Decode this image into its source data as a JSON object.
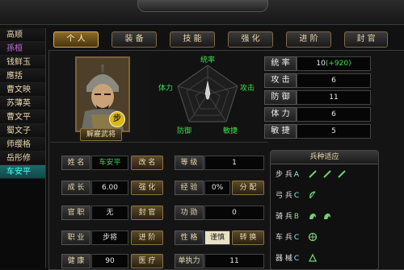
{
  "tabs": [
    "个 人",
    "装 备",
    "技 能",
    "强 化",
    "进 阶",
    "封 官"
  ],
  "generals": [
    "高顺",
    "孫桓",
    "钱鲜玉",
    "應括",
    "曹文映",
    "苏薄英",
    "曹文平",
    "蜀文子",
    "师缨格",
    "岳彤修",
    "车安平"
  ],
  "portrait": {
    "badge": "步",
    "button": "解雇武将"
  },
  "radar": {
    "top": "统率",
    "right": "攻击",
    "left": "体力",
    "bottom_left": "防御",
    "bottom_right": "敏捷"
  },
  "stats": [
    {
      "label": "统 率",
      "value": "10",
      "bonus": "(+920)"
    },
    {
      "label": "攻 击",
      "value": "6"
    },
    {
      "label": "防 御",
      "value": "11"
    },
    {
      "label": "体 力",
      "value": "6"
    },
    {
      "label": "敏 捷",
      "value": "5"
    }
  ],
  "info": {
    "name_label": "姓 名",
    "name_value": "车安平",
    "rename_btn": "改 名",
    "grow_label": "成 长",
    "grow_value": "6.00",
    "strengthen_btn": "强 化",
    "rank_label": "官 职",
    "rank_value": "无",
    "promote_btn": "封 官",
    "job_label": "职 业",
    "job_value": "步将",
    "advance_btn": "进 阶",
    "health_label": "健 康",
    "health_value": "90",
    "heal_btn": "医 疗",
    "level_label": "等 级",
    "level_value": "1",
    "exp_label": "经 验",
    "exp_value": "0%",
    "assign_btn": "分 配",
    "merit_label": "功 勋",
    "merit_value": "0",
    "trait_label": "性 格",
    "trait_value": "谨慎",
    "trait_btn": "转 换",
    "exec_label": "单执力",
    "exec_value": "11"
  },
  "arms": {
    "title": "兵种适应",
    "rows": [
      {
        "name": "步 兵",
        "grade": "A",
        "icons": 3
      },
      {
        "name": "弓 兵",
        "grade": "C",
        "icons": 1
      },
      {
        "name": "骑 兵",
        "grade": "B",
        "icons": 2
      },
      {
        "name": "车 兵",
        "grade": "C",
        "icons": 1
      },
      {
        "name": "器 械",
        "grade": "C",
        "icons": 1
      }
    ]
  },
  "colors": {
    "accent": "#d6b15a",
    "green": "#39e04c",
    "cyan": "#4ff"
  }
}
